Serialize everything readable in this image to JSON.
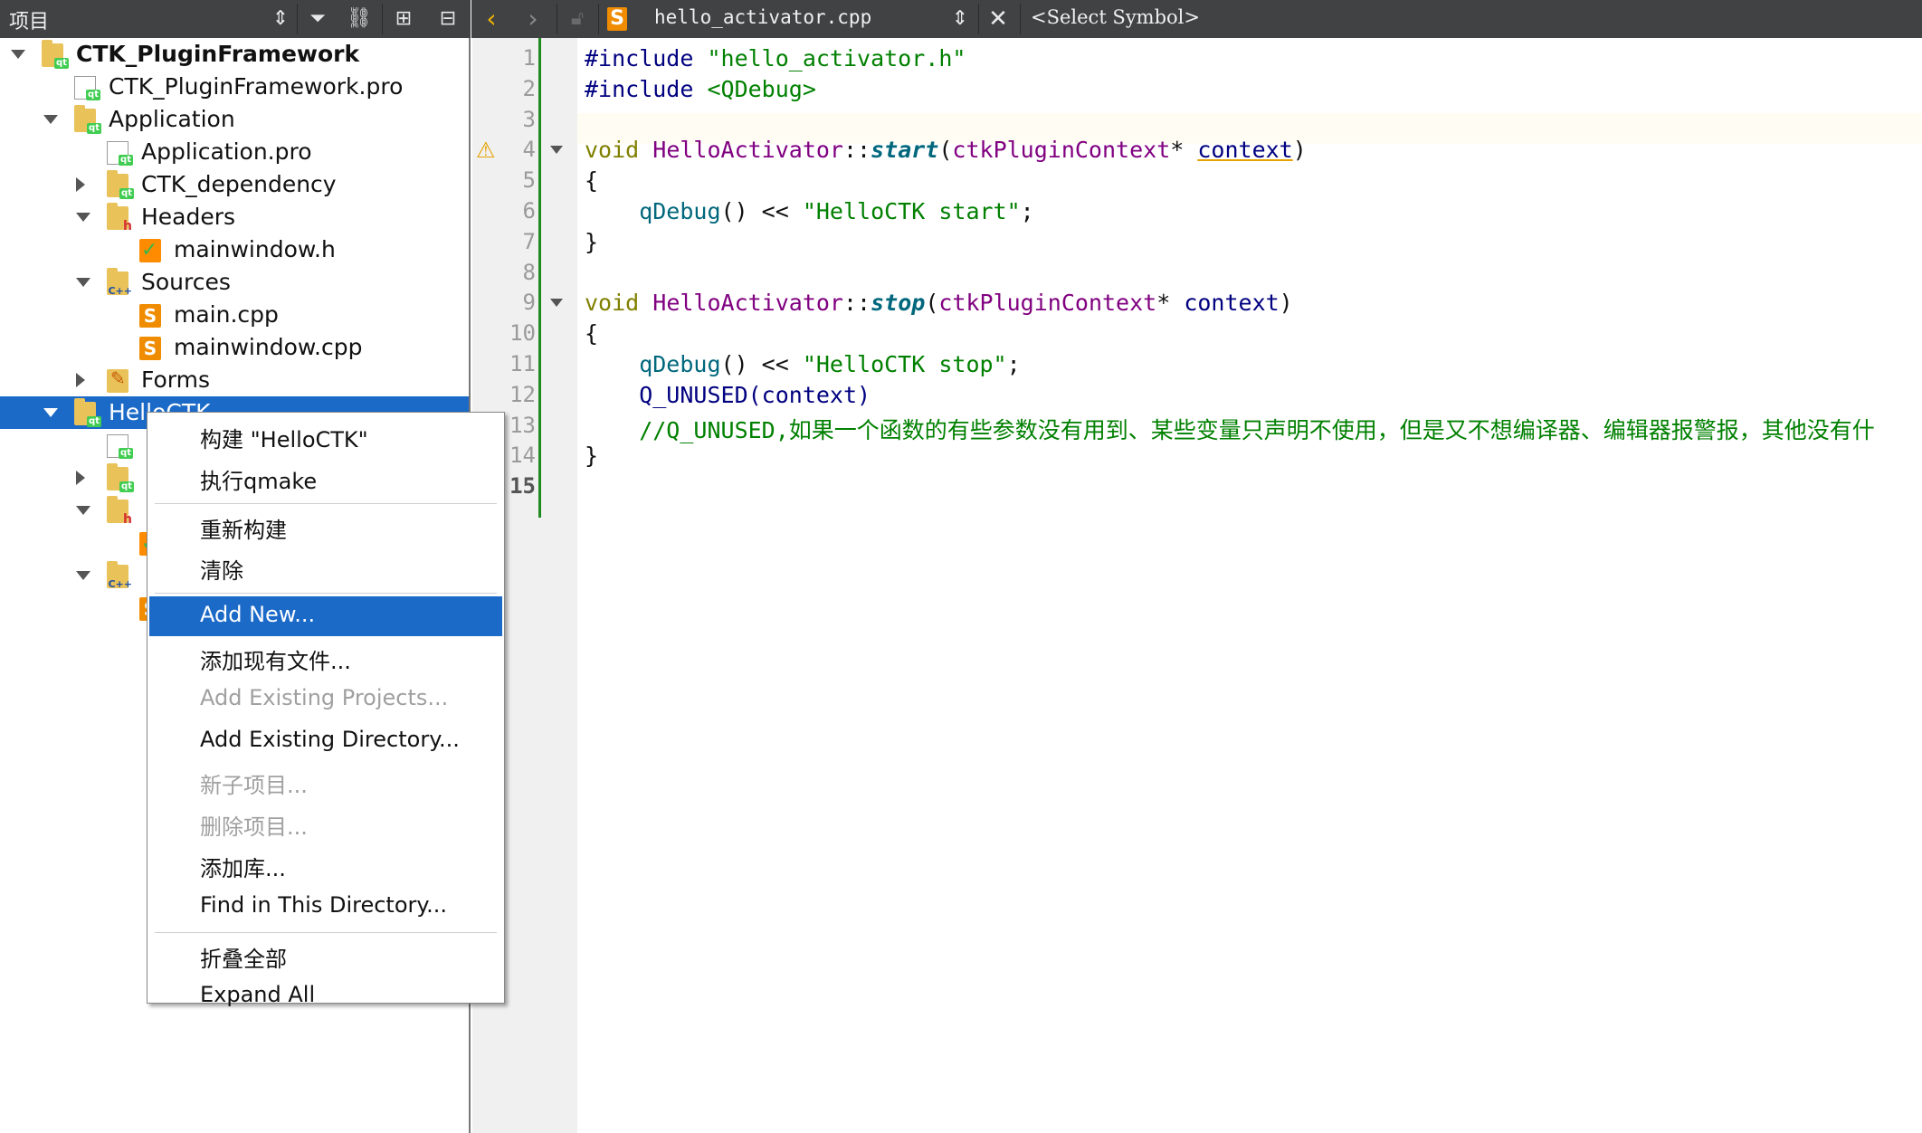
{
  "left_toolbar": {
    "title": "项目",
    "icons": [
      "up-down-arrows-icon",
      "filter-icon",
      "link-icon",
      "split-add-icon",
      "collapse-icon"
    ]
  },
  "right_toolbar": {
    "file_name": "hello_activator.cpp",
    "symbol_selector": "<Select Symbol>",
    "icons": [
      "back-arrow-icon",
      "forward-arrow-icon",
      "lock-icon",
      "cpp-file-icon",
      "up-down-arrows-icon",
      "close-icon"
    ]
  },
  "tree": {
    "rows": [
      {
        "label": "CTK_PluginFramework",
        "icon": "folder-qt",
        "arrow": "down",
        "level": 0,
        "bold": true
      },
      {
        "label": "CTK_PluginFramework.pro",
        "icon": "file-qt",
        "arrow": "none",
        "level": 1
      },
      {
        "label": "Application",
        "icon": "folder-qt",
        "arrow": "down",
        "level": 1
      },
      {
        "label": "Application.pro",
        "icon": "file-qt",
        "arrow": "none",
        "level": 2
      },
      {
        "label": "CTK_dependency",
        "icon": "folder-qt",
        "arrow": "right",
        "level": 2
      },
      {
        "label": "Headers",
        "icon": "folder-h",
        "arrow": "down",
        "level": 2
      },
      {
        "label": "mainwindow.h",
        "icon": "header",
        "arrow": "none",
        "level": 3
      },
      {
        "label": "Sources",
        "icon": "folder-cpp",
        "arrow": "down",
        "level": 2
      },
      {
        "label": "main.cpp",
        "icon": "cpp",
        "arrow": "none",
        "level": 3
      },
      {
        "label": "mainwindow.cpp",
        "icon": "cpp",
        "arrow": "none",
        "level": 3
      },
      {
        "label": "Forms",
        "icon": "forms",
        "arrow": "right",
        "level": 2
      },
      {
        "label": "HelloCTK",
        "icon": "folder-qt",
        "arrow": "down",
        "level": 1,
        "selected": true
      },
      {
        "label": "",
        "icon": "file-qt",
        "arrow": "none",
        "level": 2
      },
      {
        "label": "",
        "icon": "folder-qt",
        "arrow": "right",
        "level": 2
      },
      {
        "label": "",
        "icon": "folder-h",
        "arrow": "down",
        "level": 2
      },
      {
        "label": "",
        "icon": "header",
        "arrow": "none",
        "level": 3
      },
      {
        "label": "",
        "icon": "folder-cpp",
        "arrow": "down",
        "level": 2
      },
      {
        "label": "",
        "icon": "cpp",
        "arrow": "none",
        "level": 3
      }
    ]
  },
  "editor": {
    "line_numbers": [
      "1",
      "2",
      "3",
      "4",
      "5",
      "6",
      "7",
      "8",
      "9",
      "10",
      "11",
      "12",
      "13",
      "14",
      "15"
    ],
    "current_line": "15",
    "lines": [
      [
        {
          "t": "#include ",
          "c": "dir"
        },
        {
          "t": "\"hello_activator.h\"",
          "c": "inc"
        }
      ],
      [
        {
          "t": "#include ",
          "c": "dir"
        },
        {
          "t": "<QDebug>",
          "c": "inc"
        }
      ],
      [],
      [
        {
          "t": "void ",
          "c": "kw"
        },
        {
          "t": "HelloActivator",
          "c": "cls"
        },
        {
          "t": "::",
          "c": "pun"
        },
        {
          "t": "start",
          "c": "fn"
        },
        {
          "t": "(",
          "c": "pun"
        },
        {
          "t": "ctkPluginContext",
          "c": "cls"
        },
        {
          "t": "* ",
          "c": "pun"
        },
        {
          "t": "context",
          "c": "mac ul"
        },
        {
          "t": ")",
          "c": "pun"
        }
      ],
      [
        {
          "t": "{",
          "c": "pun"
        }
      ],
      [
        {
          "t": "    qDebug",
          "c": "call"
        },
        {
          "t": "() << ",
          "c": "pun"
        },
        {
          "t": "\"HelloCTK start\"",
          "c": "str"
        },
        {
          "t": ";",
          "c": "pun"
        }
      ],
      [
        {
          "t": "}",
          "c": "pun"
        }
      ],
      [],
      [
        {
          "t": "void ",
          "c": "kw"
        },
        {
          "t": "HelloActivator",
          "c": "cls"
        },
        {
          "t": "::",
          "c": "pun"
        },
        {
          "t": "stop",
          "c": "fn"
        },
        {
          "t": "(",
          "c": "pun"
        },
        {
          "t": "ctkPluginContext",
          "c": "cls"
        },
        {
          "t": "* ",
          "c": "pun"
        },
        {
          "t": "context",
          "c": "mac"
        },
        {
          "t": ")",
          "c": "pun"
        }
      ],
      [
        {
          "t": "{",
          "c": "pun"
        }
      ],
      [
        {
          "t": "    qDebug",
          "c": "call"
        },
        {
          "t": "() << ",
          "c": "pun"
        },
        {
          "t": "\"HelloCTK stop\"",
          "c": "str"
        },
        {
          "t": ";",
          "c": "pun"
        }
      ],
      [
        {
          "t": "    Q_UNUSED",
          "c": "mac"
        },
        {
          "t": "(context)",
          "c": "mac"
        }
      ],
      [
        {
          "t": "    //Q_UNUSED,如果一个函数的有些参数没有用到、某些变量只声明不使用，但是又不想编译器、编辑器报警报，其他没有什",
          "c": "cmt"
        }
      ],
      [
        {
          "t": "}",
          "c": "pun"
        }
      ],
      []
    ],
    "fold_lines": [
      "4",
      "9"
    ],
    "warning_line": "4"
  },
  "context_menu": {
    "items": [
      {
        "label": "构建 \"HelloCTK\"",
        "state": "normal"
      },
      {
        "label": "执行qmake",
        "state": "normal"
      },
      {
        "sep": true
      },
      {
        "label": "重新构建",
        "state": "normal"
      },
      {
        "label": "清除",
        "state": "normal"
      },
      {
        "sep": true
      },
      {
        "label": "Add New...",
        "state": "active"
      },
      {
        "label": "添加现有文件...",
        "state": "normal"
      },
      {
        "label": "Add Existing Projects...",
        "state": "disabled"
      },
      {
        "label": "Add Existing Directory...",
        "state": "normal"
      },
      {
        "label": "新子项目...",
        "state": "disabled"
      },
      {
        "label": "删除项目...",
        "state": "disabled"
      },
      {
        "label": "添加库...",
        "state": "normal"
      },
      {
        "label": "Find in This Directory...",
        "state": "normal"
      },
      {
        "sep": true
      },
      {
        "label": "折叠全部",
        "state": "normal"
      },
      {
        "label": "Expand All",
        "state": "normal"
      }
    ]
  },
  "colors": {
    "toolbar": "#404244",
    "selection": "#1b6ac8",
    "fold_marker": "#1f8a1f",
    "warning": "#e6a200"
  }
}
